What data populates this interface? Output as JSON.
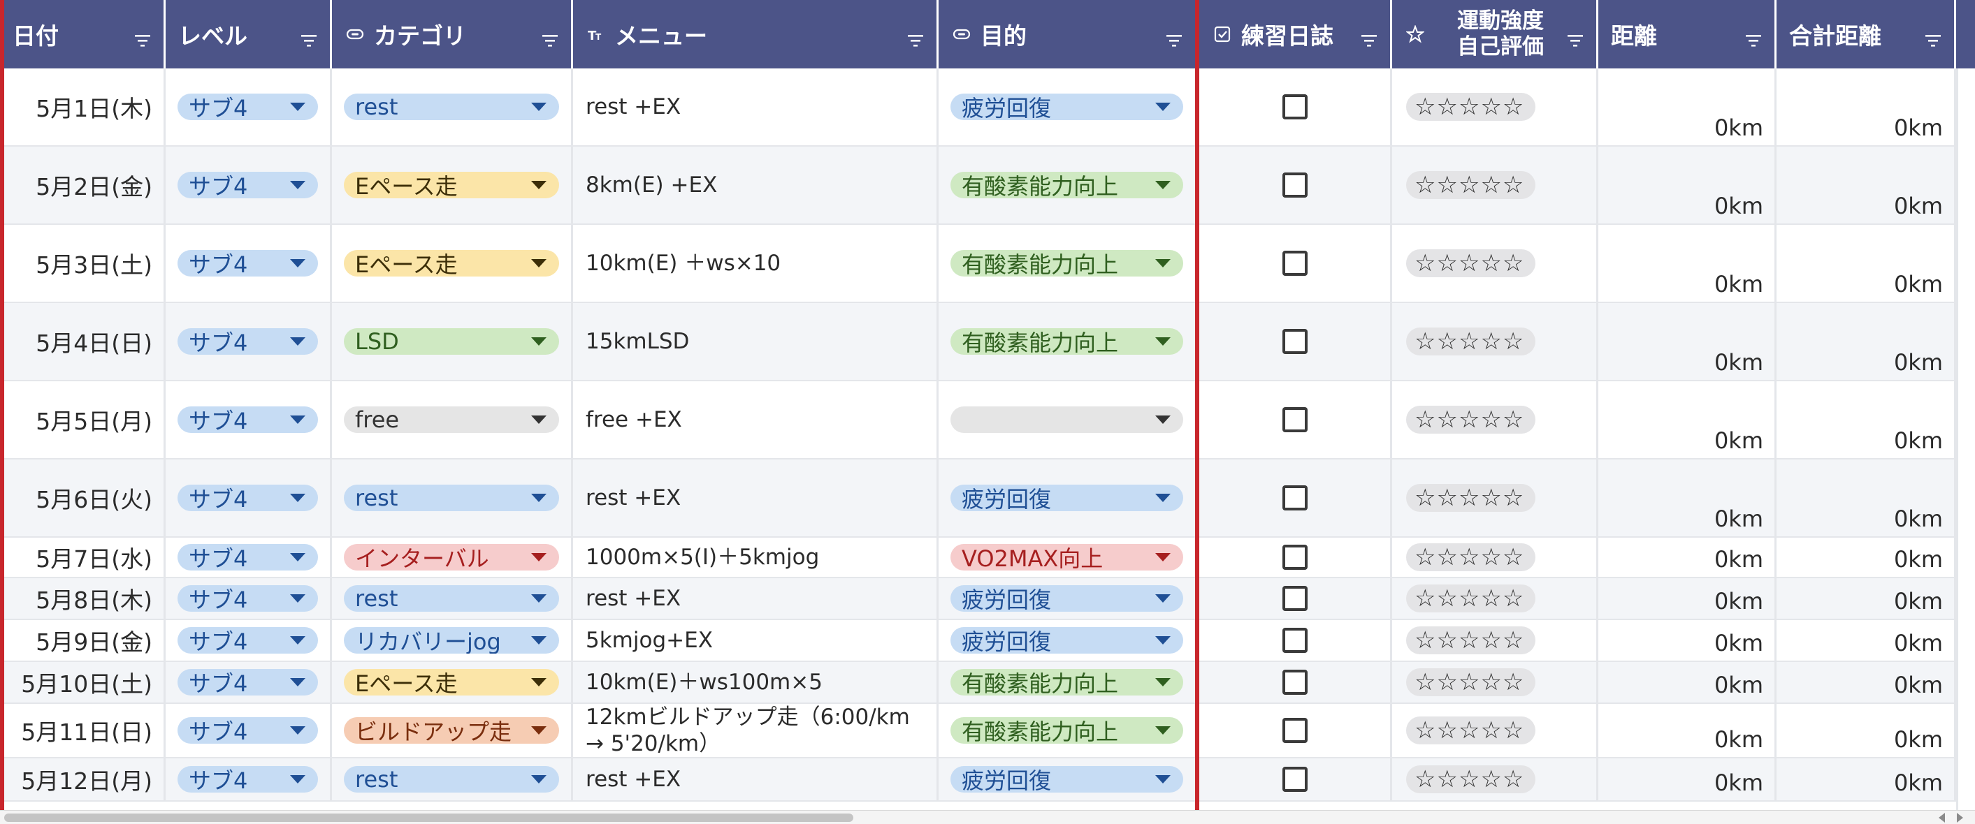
{
  "columns": [
    {
      "key": "date",
      "title": "日付",
      "icon": "none"
    },
    {
      "key": "level",
      "title": "レベル",
      "icon": "none"
    },
    {
      "key": "category",
      "title": "カテゴリ",
      "icon": "dropdown-field-icon"
    },
    {
      "key": "menu",
      "title": "メニュー",
      "icon": "text-field-icon"
    },
    {
      "key": "purpose",
      "title": "目的",
      "icon": "dropdown-field-icon"
    },
    {
      "key": "log",
      "title": "練習日誌",
      "icon": "checkbox-field-icon"
    },
    {
      "key": "rating",
      "title": "運動強度\n自己評価",
      "icon": "star-field-icon"
    },
    {
      "key": "distance",
      "title": "距離",
      "icon": "none"
    },
    {
      "key": "total",
      "title": "合計距離",
      "icon": "none"
    }
  ],
  "colors": {
    "header_bg": "#4c5488",
    "freeze_line": "#c8262c",
    "chips": {
      "blue": {
        "bg": "#c6dcf4",
        "fg": "#1f4f95"
      },
      "yellow": {
        "bg": "#fbe5a8",
        "fg": "#3c2e08"
      },
      "green": {
        "bg": "#cfe9c2",
        "fg": "#2f5f1f"
      },
      "gray": {
        "bg": "#e5e5e5",
        "fg": "#333333"
      },
      "red": {
        "bg": "#f6cccc",
        "fg": "#a61f1f"
      },
      "orange": {
        "bg": "#f6ccb3",
        "fg": "#7a2e0e"
      }
    }
  },
  "rows": [
    {
      "date": "5月1日(木)",
      "level": "サブ4",
      "level_color": "blue",
      "category": "rest",
      "category_color": "blue",
      "menu": "rest +EX",
      "purpose": "疲労回復",
      "purpose_color": "blue",
      "log_checked": false,
      "rating": "☆☆☆☆☆",
      "distance": "0km",
      "total": "0km"
    },
    {
      "date": "5月2日(金)",
      "level": "サブ4",
      "level_color": "blue",
      "category": "Eペース走",
      "category_color": "yellow",
      "menu": "8km(E) +EX",
      "purpose": "有酸素能力向上",
      "purpose_color": "green",
      "log_checked": false,
      "rating": "☆☆☆☆☆",
      "distance": "0km",
      "total": "0km"
    },
    {
      "date": "5月3日(土)",
      "level": "サブ4",
      "level_color": "blue",
      "category": "Eペース走",
      "category_color": "yellow",
      "menu": "10km(E) ＋ws×10",
      "purpose": "有酸素能力向上",
      "purpose_color": "green",
      "log_checked": false,
      "rating": "☆☆☆☆☆",
      "distance": "0km",
      "total": "0km"
    },
    {
      "date": "5月4日(日)",
      "level": "サブ4",
      "level_color": "blue",
      "category": "LSD",
      "category_color": "green",
      "menu": "15kmLSD",
      "purpose": "有酸素能力向上",
      "purpose_color": "green",
      "log_checked": false,
      "rating": "☆☆☆☆☆",
      "distance": "0km",
      "total": "0km"
    },
    {
      "date": "5月5日(月)",
      "level": "サブ4",
      "level_color": "blue",
      "category": "free",
      "category_color": "gray",
      "menu": "free +EX",
      "purpose": "",
      "purpose_color": "gray",
      "log_checked": false,
      "rating": "☆☆☆☆☆",
      "distance": "0km",
      "total": "0km"
    },
    {
      "date": "5月6日(火)",
      "level": "サブ4",
      "level_color": "blue",
      "category": "rest",
      "category_color": "blue",
      "menu": "rest +EX",
      "purpose": "疲労回復",
      "purpose_color": "blue",
      "log_checked": false,
      "rating": "☆☆☆☆☆",
      "distance": "0km",
      "total": "0km"
    },
    {
      "date": "5月7日(水)",
      "level": "サブ4",
      "level_color": "blue",
      "category": "インターバル",
      "category_color": "red",
      "menu": "1000m×5(I)＋5kmjog",
      "purpose": "VO2MAX向上",
      "purpose_color": "red",
      "log_checked": false,
      "rating": "☆☆☆☆☆",
      "distance": "0km",
      "total": "0km"
    },
    {
      "date": "5月8日(木)",
      "level": "サブ4",
      "level_color": "blue",
      "category": "rest",
      "category_color": "blue",
      "menu": "rest +EX",
      "purpose": "疲労回復",
      "purpose_color": "blue",
      "log_checked": false,
      "rating": "☆☆☆☆☆",
      "distance": "0km",
      "total": "0km"
    },
    {
      "date": "5月9日(金)",
      "level": "サブ4",
      "level_color": "blue",
      "category": "リカバリーjog",
      "category_color": "blue",
      "menu": "5kmjog+EX",
      "purpose": "疲労回復",
      "purpose_color": "blue",
      "log_checked": false,
      "rating": "☆☆☆☆☆",
      "distance": "0km",
      "total": "0km"
    },
    {
      "date": "5月10日(土)",
      "level": "サブ4",
      "level_color": "blue",
      "category": "Eペース走",
      "category_color": "yellow",
      "menu": "10km(E)＋ws100m×5",
      "purpose": "有酸素能力向上",
      "purpose_color": "green",
      "log_checked": false,
      "rating": "☆☆☆☆☆",
      "distance": "0km",
      "total": "0km"
    },
    {
      "date": "5月11日(日)",
      "level": "サブ4",
      "level_color": "blue",
      "category": "ビルドアップ走",
      "category_color": "orange",
      "menu": "12kmビルドアップ走（6:00/km\n→ 5'20/km）",
      "purpose": "有酸素能力向上",
      "purpose_color": "green",
      "log_checked": false,
      "rating": "☆☆☆☆☆",
      "distance": "0km",
      "total": "0km"
    },
    {
      "date": "5月12日(月)",
      "level": "サブ4",
      "level_color": "blue",
      "category": "rest",
      "category_color": "blue",
      "menu": "rest +EX",
      "purpose": "疲労回復",
      "purpose_color": "blue",
      "log_checked": false,
      "rating": "☆☆☆☆☆",
      "distance": "0km",
      "total": "0km"
    }
  ]
}
